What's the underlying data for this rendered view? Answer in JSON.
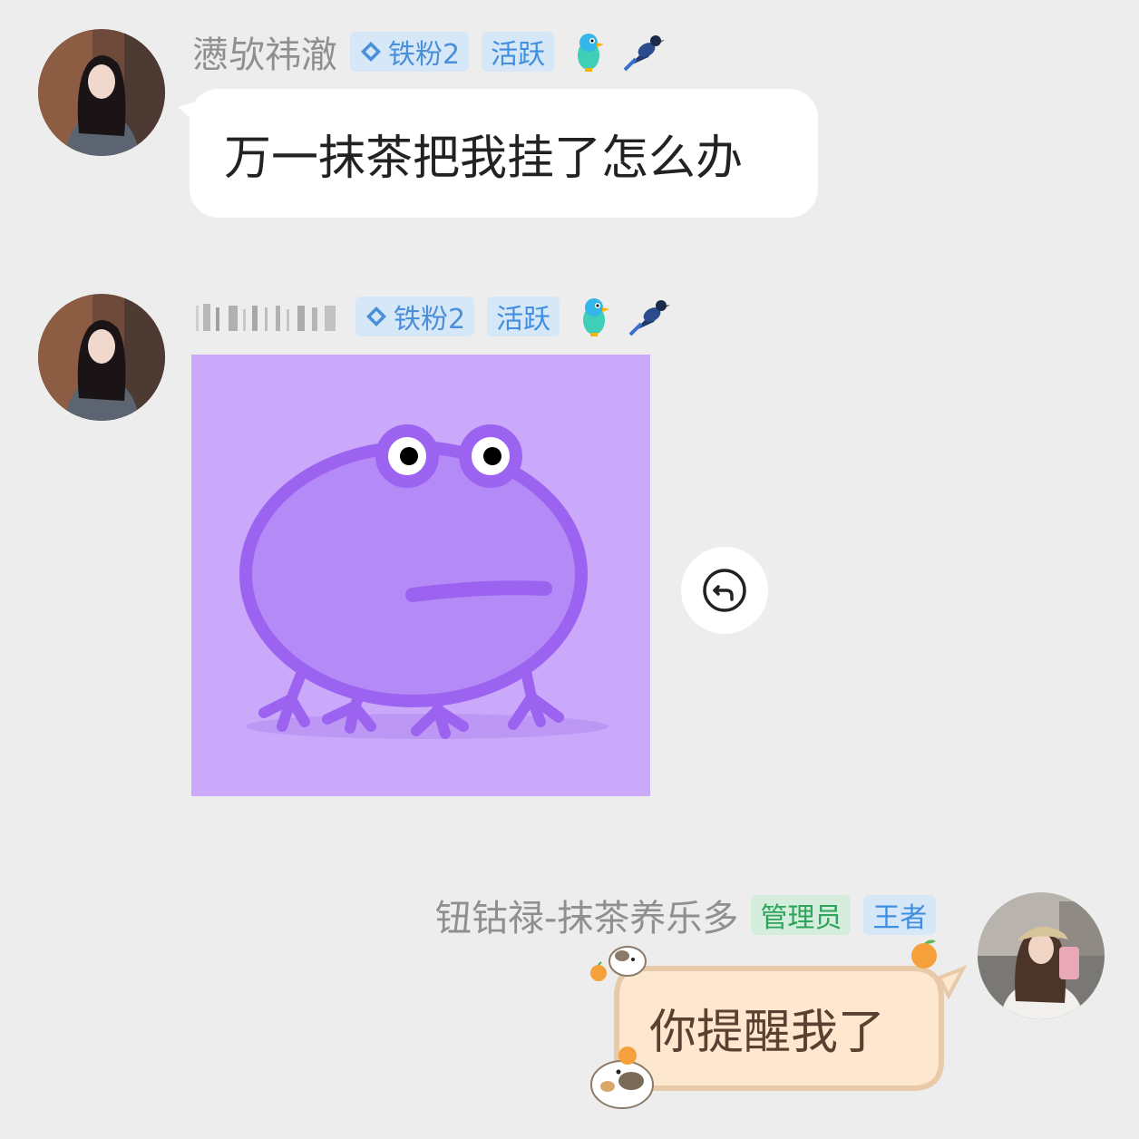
{
  "messages": [
    {
      "sender": {
        "name": "懑欤祎澈",
        "badges": {
          "fan": "铁粉2",
          "active": "活跃"
        }
      },
      "type": "text",
      "text": "万一抹茶把我挂了怎么办"
    },
    {
      "sender": {
        "name_obscured": true,
        "badges": {
          "fan": "铁粉2",
          "active": "活跃"
        }
      },
      "type": "image",
      "image": "purple-frog-sticker",
      "action_icon": "reply-icon"
    },
    {
      "sender": {
        "name": "钮钴禄-抹茶养乐多",
        "badges": {
          "role": "管理员",
          "title": "王者"
        }
      },
      "type": "text",
      "text": "你提醒我了",
      "outgoing": true
    }
  ],
  "colors": {
    "background": "#ededed",
    "bubble": "#ffffff",
    "decorated_bubble": "#fde7cf",
    "frog_bg": "#caa9fb",
    "frog_body": "#b48af6",
    "frog_outline": "#9c63f1",
    "badge_blue": "#4a8fd9",
    "badge_green": "#2ea35b"
  }
}
